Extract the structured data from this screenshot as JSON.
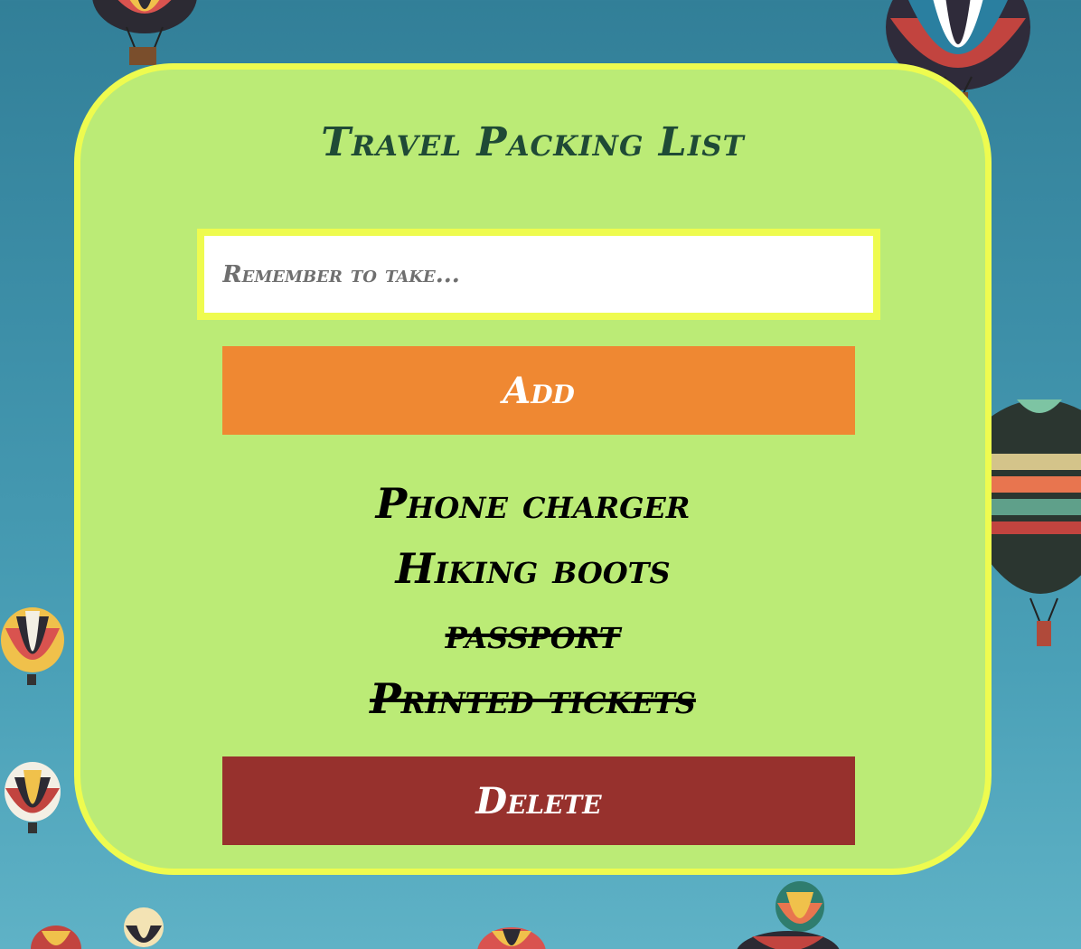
{
  "app": {
    "title": "Travel Packing List"
  },
  "input": {
    "placeholder": "Remember to take...",
    "value": ""
  },
  "buttons": {
    "add_label": "Add",
    "delete_label": "Delete"
  },
  "items": [
    {
      "label": "Phone charger",
      "done": false
    },
    {
      "label": "Hiking boots",
      "done": false
    },
    {
      "label": "passport",
      "done": true
    },
    {
      "label": "Printed tickets",
      "done": true
    }
  ],
  "colors": {
    "card_background": "#bbeb76",
    "card_border": "#eefb4f",
    "title": "#1f4a36",
    "add_button": "#ef8832",
    "delete_button": "#97312d",
    "sky": "#3d8fa8"
  },
  "background": {
    "image": "hot-air-balloons-sky"
  }
}
